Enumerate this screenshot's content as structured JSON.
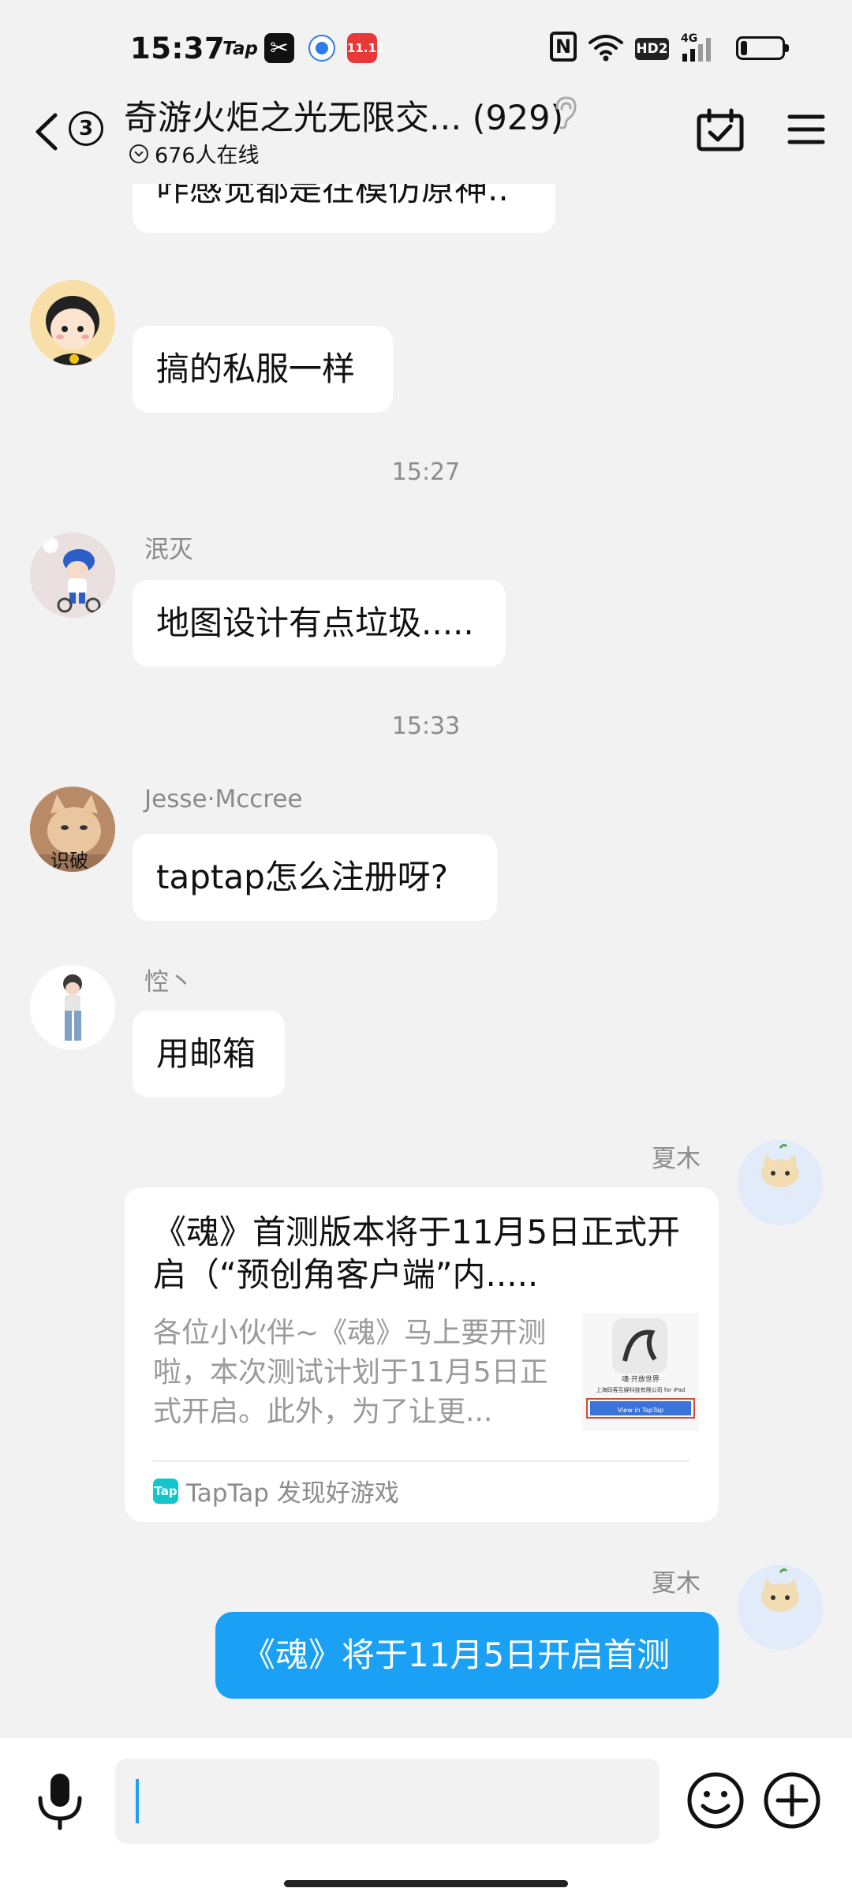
{
  "status_bar": {
    "time": "15:37",
    "tap_label": "Tap",
    "capcut_label": "✂",
    "mall_label": "11.11",
    "nfc_label": "N",
    "hd_label": "HD2",
    "network_label": "4G",
    "battery_level": 0.15
  },
  "header": {
    "unread_count": "3",
    "title": "奇游火炬之光无限交... (929)",
    "online": "676人在线"
  },
  "messages": [
    {
      "text": "咋感觉都是在模仿原神.."
    },
    {
      "text": "搞的私服一样"
    },
    {
      "timestamp": "15:27"
    },
    {
      "sender": "泯灭",
      "text": "地图设计有点垃圾....."
    },
    {
      "timestamp": "15:33"
    },
    {
      "sender": "Jesse·Mccree",
      "avatar_label": "识破",
      "text": "taptap怎么注册呀?"
    },
    {
      "sender": "悾丶",
      "text": "用邮箱"
    },
    {
      "sender": "夏木",
      "card": {
        "title": "《魂》首测版本将于11月5日正式开启（“预创角客户端”内.....",
        "description": "各位小伙伴~《魂》马上要开测啦，本次测试计划于11月5日正式开启。此外，为了让更...",
        "thumb_caption": "魂·开放世界",
        "thumb_company": "上海码客互娱科技有限公司 for iPad",
        "thumb_button": "View in TapTap",
        "source": "TapTap 发现好游戏",
        "source_icon": "Tap"
      }
    },
    {
      "sender": "夏木",
      "text": "《魂》将于11月5日开启首测"
    }
  ],
  "input": {
    "value": "",
    "placeholder": ""
  },
  "colors": {
    "accent": "#1aa0f5",
    "background": "#f2f2f2",
    "bubble": "#ffffff"
  },
  "icons": [
    "back-icon",
    "ear-icon",
    "calendar-check-icon",
    "menu-icon",
    "mic-icon",
    "emoji-icon",
    "plus-icon"
  ]
}
